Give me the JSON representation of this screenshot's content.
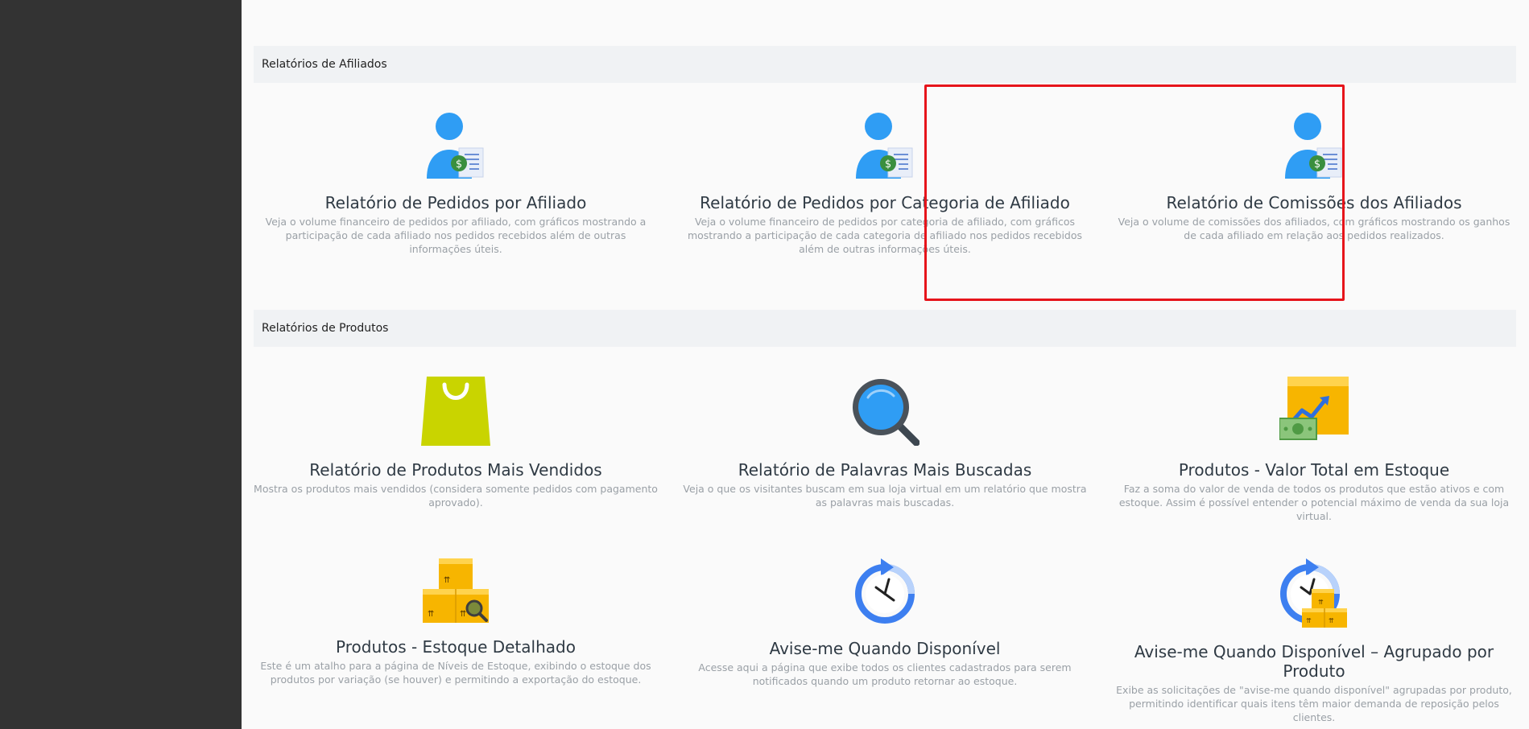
{
  "sections": {
    "affiliates": {
      "title": "Relatórios de Afiliados",
      "cards": [
        {
          "icon": "affiliate-report-icon",
          "title": "Relatório de Pedidos por Afiliado",
          "desc": "Veja o volume financeiro de pedidos por afiliado, com gráficos mostrando a participação de cada afiliado nos pedidos recebidos além de outras informações úteis."
        },
        {
          "icon": "affiliate-category-report-icon",
          "title": "Relatório de Pedidos por Categoria de Afiliado",
          "desc": "Veja o volume financeiro de pedidos por categoria de afiliado, com gráficos mostrando a participação de cada categoria de afiliado nos pedidos recebidos além de outras informações úteis."
        },
        {
          "icon": "affiliate-commission-icon",
          "title": "Relatório de Comissões dos Afiliados",
          "desc": "Veja o volume de comissões dos afiliados, com gráficos mostrando os ganhos de cada afiliado em relação aos pedidos realizados."
        }
      ]
    },
    "products": {
      "title": "Relatórios de Produtos",
      "cards": [
        {
          "icon": "shopping-bag-icon",
          "title": "Relatório de Produtos Mais Vendidos",
          "desc": "Mostra os produtos mais vendidos (considera somente pedidos com pagamento aprovado)."
        },
        {
          "icon": "magnifier-icon",
          "title": "Relatório de Palavras Mais Buscadas",
          "desc": "Veja o que os visitantes buscam em sua loja virtual em um relatório que mostra as palavras mais buscadas."
        },
        {
          "icon": "stock-value-icon",
          "title": "Produtos - Valor Total em Estoque",
          "desc": "Faz a soma do valor de venda de todos os produtos que estão ativos e com estoque. Assim é possível entender o potencial máximo de venda da sua loja virtual."
        },
        {
          "icon": "stock-boxes-icon",
          "title": "Produtos - Estoque Detalhado",
          "desc": "Este é um atalho para a página de Níveis de Estoque, exibindo o estoque dos produtos por variação (se houver) e permitindo a exportação do estoque."
        },
        {
          "icon": "clock-refresh-icon",
          "title": "Avise-me Quando Disponível",
          "desc": "Acesse aqui a página que exibe todos os clientes cadastrados para serem notificados quando um produto retornar ao estoque."
        },
        {
          "icon": "clock-boxes-icon",
          "title": "Avise-me Quando Disponível – Agrupado por Produto",
          "desc": "Exibe as solicitações de \"avise-me quando disponível\" agrupadas por produto, permitindo identificar quais itens têm maior demanda de reposição pelos clientes."
        }
      ]
    }
  },
  "colors": {
    "sidebar": "#333333",
    "accent_blue": "#2f9df4",
    "highlight": "#e6141b"
  }
}
